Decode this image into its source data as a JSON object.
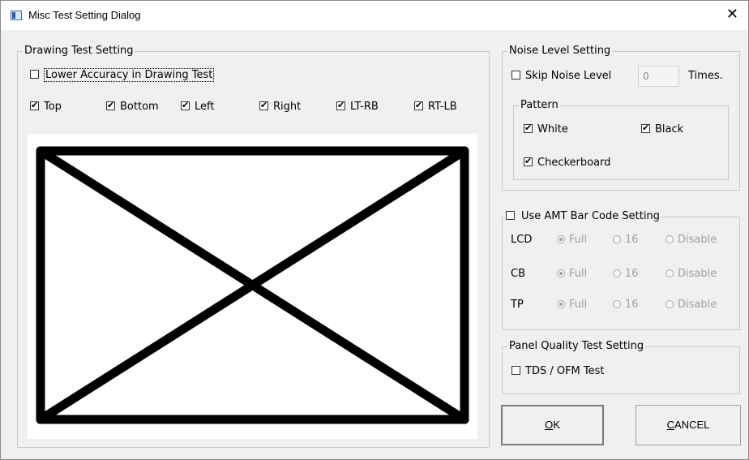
{
  "window": {
    "title": "Misc Test Setting Dialog",
    "close_glyph": "✕"
  },
  "drawing": {
    "group_label": "Drawing Test Setting",
    "lower_accuracy": {
      "label": "Lower Accuracy in Drawing Test",
      "checked": false
    },
    "lines": [
      {
        "label": "Top",
        "checked": true
      },
      {
        "label": "Bottom",
        "checked": true
      },
      {
        "label": "Left",
        "checked": true
      },
      {
        "label": "Right",
        "checked": true
      },
      {
        "label": "LT-RB",
        "checked": true
      },
      {
        "label": "RT-LB",
        "checked": true
      }
    ]
  },
  "noise": {
    "group_label": "Noise Level Setting",
    "skip_label": "Skip Noise Level",
    "skip_checked": false,
    "times_value": "0",
    "times_suffix": "Times.",
    "pattern": {
      "group_label": "Pattern",
      "white": {
        "label": "White",
        "checked": true
      },
      "black": {
        "label": "Black",
        "checked": true
      },
      "checkerboard": {
        "label": "Checkerboard",
        "checked": true
      }
    }
  },
  "amt": {
    "group_label": "Use AMT Bar Code Setting",
    "checked": false,
    "option_full": "Full",
    "option_16": "16",
    "option_disable": "Disable",
    "rows": [
      {
        "label": "LCD",
        "selected": "Full"
      },
      {
        "label": "CB",
        "selected": "Full"
      },
      {
        "label": "TP",
        "selected": "Full"
      }
    ]
  },
  "panel": {
    "group_label": "Panel Quality Test Setting",
    "tds_label": "TDS / OFM Test",
    "tds_checked": false
  },
  "buttons": {
    "ok_mnemonic": "O",
    "ok_rest": "K",
    "cancel_mnemonic": "C",
    "cancel_rest": "ANCEL"
  }
}
